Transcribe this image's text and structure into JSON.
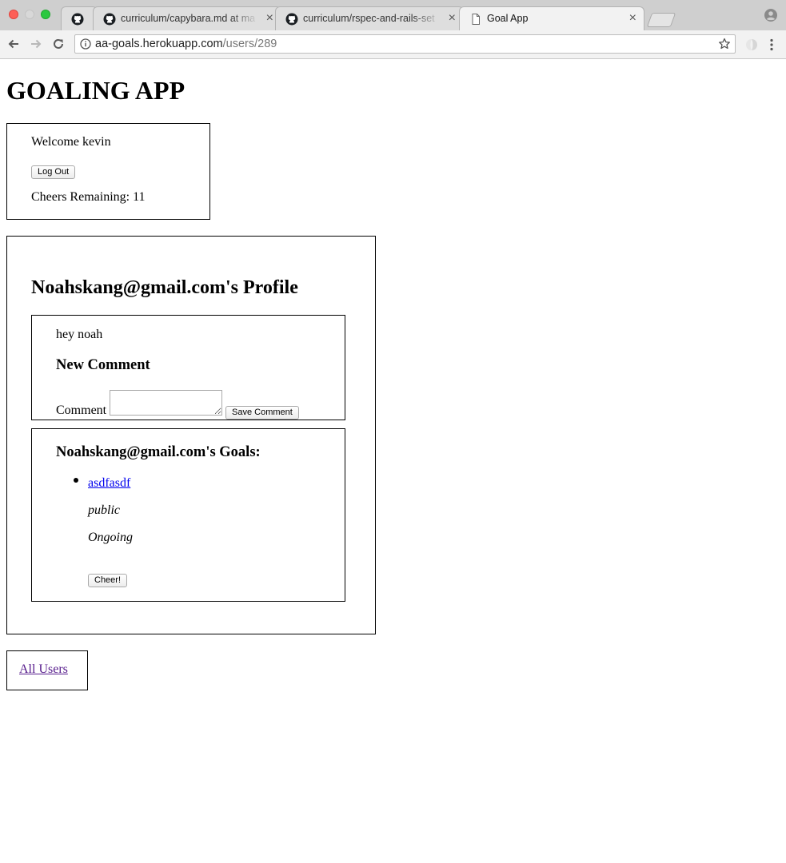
{
  "browser": {
    "tabs": [
      {
        "title": "",
        "icon": "github-icon",
        "active": false
      },
      {
        "title": "curriculum/capybara.md at ma",
        "icon": "github-icon",
        "active": false
      },
      {
        "title": "curriculum/rspec-and-rails-set",
        "icon": "github-icon",
        "active": false
      },
      {
        "title": "Goal App",
        "icon": "page-icon",
        "active": true
      }
    ],
    "address": {
      "host": "aa-goals.herokuapp.com",
      "path": "/users/289"
    }
  },
  "page": {
    "app_title": "GOALING APP",
    "welcome": {
      "text": "Welcome kevin",
      "logout_label": "Log Out",
      "cheers_remaining": "Cheers Remaining: 11"
    },
    "profile": {
      "heading": "Noahskang@gmail.com's Profile",
      "comments": [
        "hey noah"
      ],
      "new_comment_heading": "New Comment",
      "comment_label": "Comment",
      "comment_value": "",
      "save_label": "Save Comment",
      "goals_heading": "Noahskang@gmail.com's Goals:",
      "goals": [
        {
          "title": "asdfasdf",
          "privacy": "public",
          "status": "Ongoing",
          "cheer_label": "Cheer!"
        }
      ]
    },
    "all_users_label": "All Users"
  },
  "colors": {
    "link": "#0000ee",
    "visited_link": "#551a8b",
    "close_red": "#fd5f57",
    "maximize_green": "#2bc840"
  }
}
